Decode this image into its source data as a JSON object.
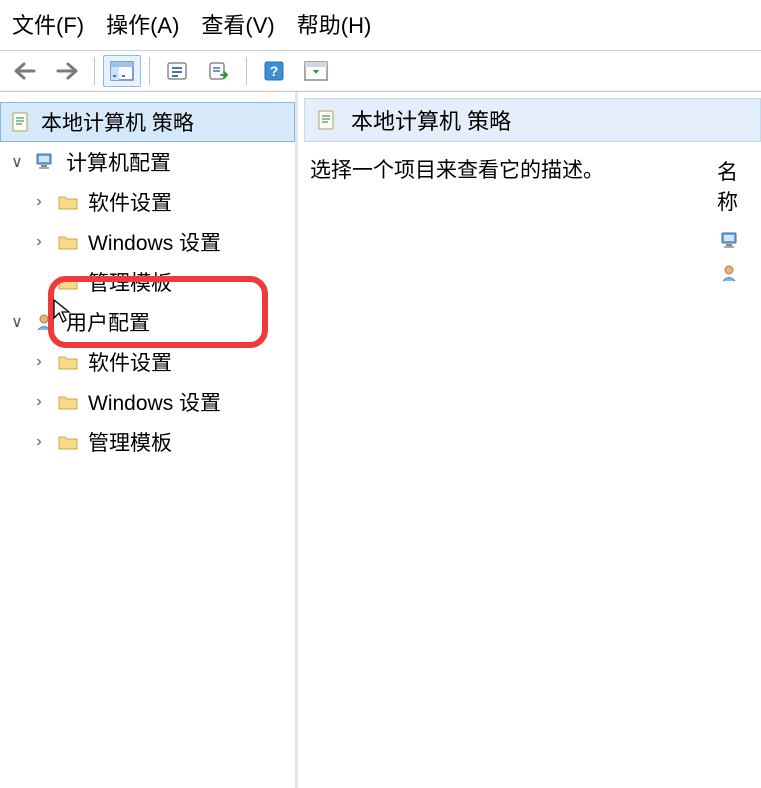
{
  "menubar": {
    "file": "文件(F)",
    "action": "操作(A)",
    "view": "查看(V)",
    "help": "帮助(H)"
  },
  "tree": {
    "root": "本地计算机 策略",
    "computer_config": "计算机配置",
    "computer_children": {
      "software": "软件设置",
      "windows": "Windows 设置",
      "admin": "管理模板"
    },
    "user_config": "用户配置",
    "user_children": {
      "software": "软件设置",
      "windows": "Windows 设置",
      "admin": "管理模板"
    }
  },
  "content": {
    "header": "本地计算机 策略",
    "description": "选择一个项目来查看它的描述。",
    "right_header": "名称"
  },
  "expander": {
    "open": "∨",
    "closed": "›"
  }
}
